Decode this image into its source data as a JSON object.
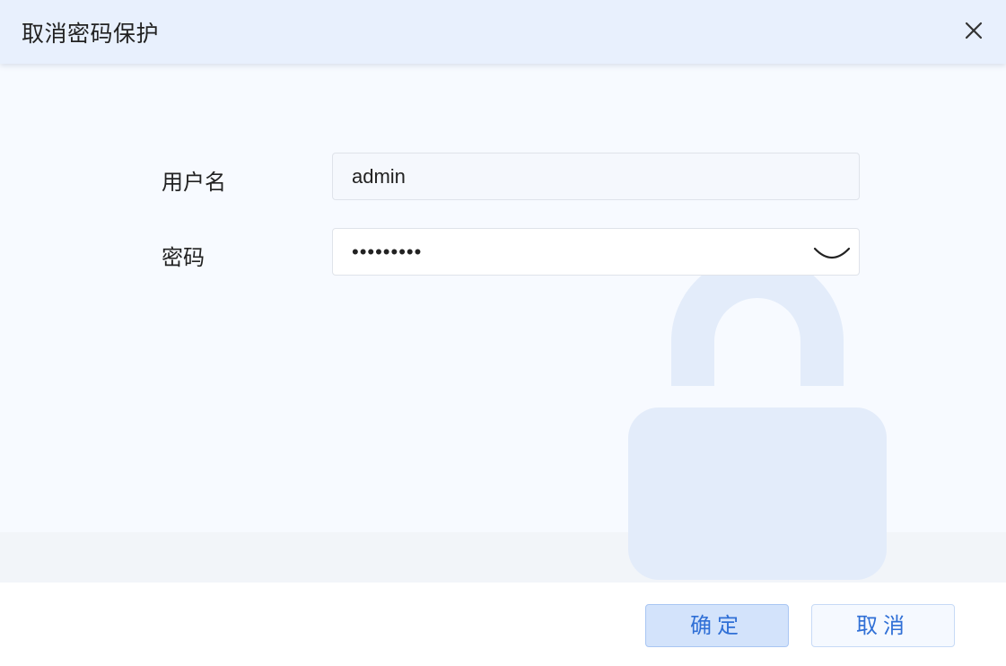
{
  "dialog": {
    "title": "取消密码保护",
    "close_icon": "close-icon"
  },
  "form": {
    "username": {
      "label": "用户名",
      "value": "admin"
    },
    "password": {
      "label": "密码",
      "value": "•••••••••",
      "toggle_icon": "eye-closed-icon"
    }
  },
  "footer": {
    "confirm_label": "确定",
    "cancel_label": "取消"
  },
  "watermark": {
    "icon": "lock-icon"
  },
  "colors": {
    "header_bg": "#e8f0fd",
    "body_bg": "#f7faff",
    "accent_text": "#2f6fd6",
    "confirm_bg": "#d3e3fb",
    "watermark": "#e3ecfa"
  }
}
